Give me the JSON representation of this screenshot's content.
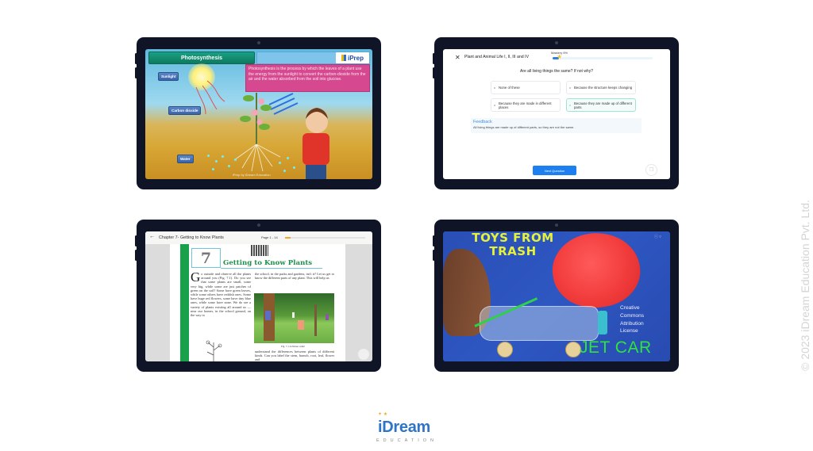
{
  "tablets": {
    "photosynthesis": {
      "title": "Photosynthesis",
      "brand": "iPrep",
      "description": "Photosynthesis is the process by which the leaves of a plant use the energy from the sunlight to convert the carbon-dioxide from the air and the water absorbed from the soil into glucose.",
      "labels": {
        "sunlight": "Sunlight",
        "carbon_dioxide": "Carbon dioxide",
        "water": "Water"
      },
      "credit": "iPrep by iDream Education"
    },
    "quiz": {
      "title": "Plant and Animal Life I, II, III and IV",
      "mastery_label": "Mastery 6%",
      "mastery_percent": 6,
      "question": "Are all living things the same? If not why?",
      "options": [
        {
          "label": "None of these",
          "selected": false
        },
        {
          "label": "Because the structure keeps changing",
          "selected": false
        },
        {
          "label": "Because they are made in different places",
          "selected": false
        },
        {
          "label": "Because they are made up of different parts",
          "selected": true
        }
      ],
      "feedback_title": "Feedback",
      "feedback_text": "All living things are made up of different parts, so they are not the same.",
      "next_button": "Next Question",
      "accent": "#1d7ff0"
    },
    "book": {
      "header_title": "Chapter 7- Getting to Know Plants",
      "page_indicator": "Page 1 - 14",
      "progress_fraction": 0.07,
      "chapter_number": "7",
      "chapter_title": "Getting to Know Plants",
      "col1_dropcap": "G",
      "col1_text": "o outside and observe all the plants around you (Fig. 7.1). Do you see that some plants are small, some very big, while some are just patches of green on the soil? Some have green leaves, while some others have reddish ones. Some have huge red flowers, some have tiny blue ones, while some have none. We do see a variety of plants existing all around us — near our homes, in the school ground, on the way to",
      "col2_text_top": "the school, in the parks and gardens, isn't it? Let us get to know the different parts of any plant. This will help us",
      "col2_text_bottom": "understand the differences between plants of different kinds. Can you label the stem, branch, root, leaf, flower and",
      "figure_caption": "Fig. 7.1 A Nature walk!"
    },
    "video": {
      "title_line1": "TOYS FROM",
      "title_line2": "TRASH",
      "license_lines": [
        "Creative",
        "Commons",
        "Attribution",
        "License"
      ],
      "subtitle": "JET CAR"
    }
  },
  "footer": {
    "logo_word": "iDream",
    "logo_sub": "EDUCATION"
  },
  "watermark": "© 2023 iDream Education Pvt. Ltd."
}
